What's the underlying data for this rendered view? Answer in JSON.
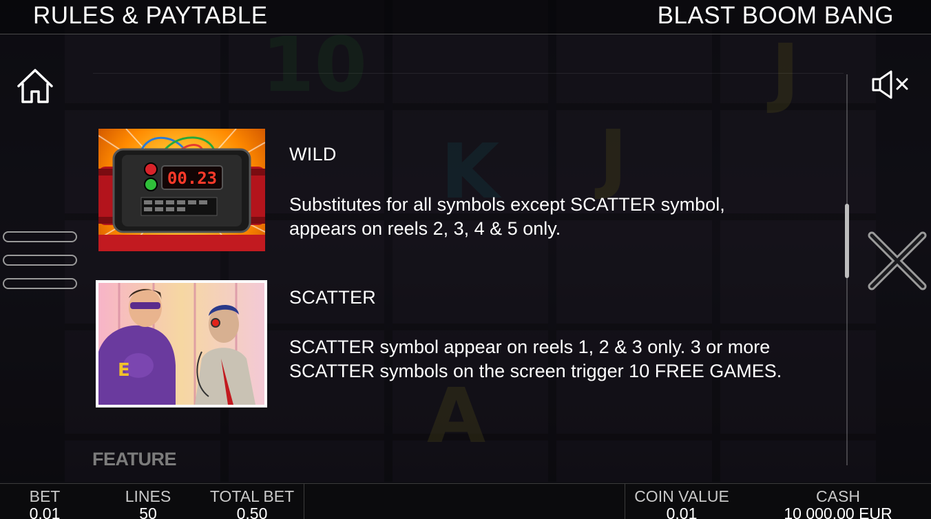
{
  "header": {
    "title": "RULES & PAYTABLE",
    "game_name": "BLAST BOOM BANG"
  },
  "icons": {
    "home": "home-icon",
    "menu": "hamburger-menu-icon",
    "sound": "speaker-muted-icon",
    "close": "close-icon"
  },
  "sections": [
    {
      "title": "WILD",
      "lines": [
        "Substitutes for all symbols except SCATTER symbol,",
        "appears on reels 2, 3, 4 & 5 only."
      ],
      "symbol": {
        "timer_text": "00.23"
      }
    },
    {
      "title": "SCATTER",
      "lines": [
        "SCATTER symbol appear on reels 1, 2 & 3 only. 3 or more",
        "SCATTER symbols on the screen trigger 10 FREE GAMES."
      ]
    }
  ],
  "next_section_title": "FEATURE",
  "footer": {
    "bet": {
      "label": "BET",
      "value": "0.01"
    },
    "lines": {
      "label": "LINES",
      "value": "50"
    },
    "total_bet": {
      "label": "TOTAL BET",
      "value": "0.50"
    },
    "coin_value": {
      "label": "COIN VALUE",
      "value": "0.01"
    },
    "cash": {
      "label": "CASH",
      "value": "10 000.00 EUR"
    }
  },
  "colors": {
    "background": "#0d0d12",
    "text": "#ffffff",
    "icon_outline": "#bdbdbd",
    "footer_label": "#c9c9c9"
  }
}
